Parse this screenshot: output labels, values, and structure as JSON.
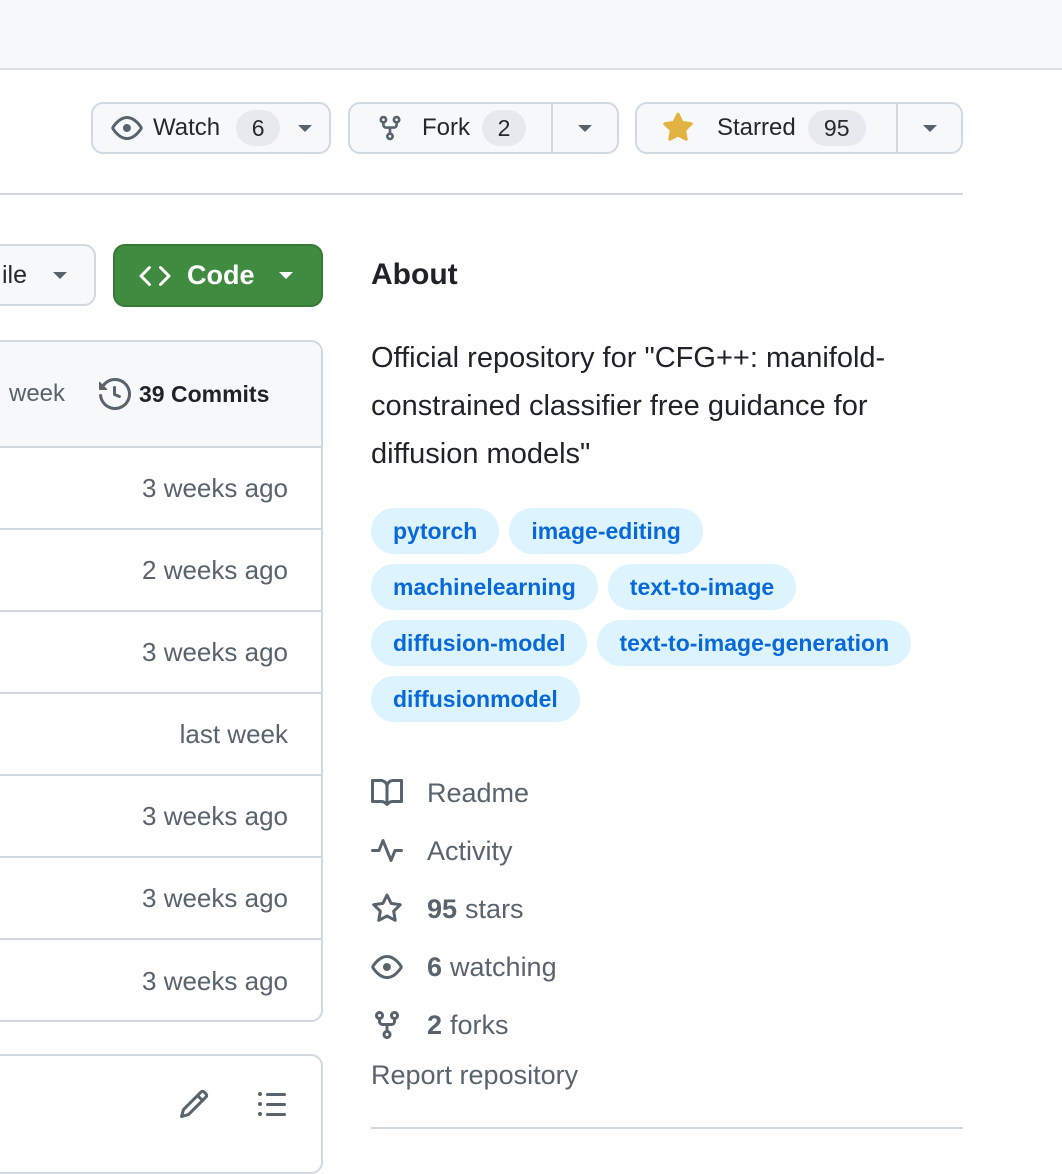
{
  "actions": {
    "watch": {
      "label": "Watch",
      "count": "6"
    },
    "fork": {
      "label": "Fork",
      "count": "2"
    },
    "star": {
      "label": "Starred",
      "count": "95"
    }
  },
  "toolbar": {
    "file_label": "ile",
    "code_label": "Code"
  },
  "files": {
    "header_time": "week",
    "commits_label": "39 Commits",
    "rows": [
      "3 weeks ago",
      "2 weeks ago",
      "3 weeks ago",
      "last week",
      "3 weeks ago",
      "3 weeks ago",
      "3 weeks ago"
    ]
  },
  "about": {
    "title": "About",
    "description": "Official repository for \"CFG++: manifold-constrained classifier free guidance for diffusion models\"",
    "topics": [
      [
        "pytorch",
        "image-editing"
      ],
      [
        "machinelearning",
        "text-to-image"
      ],
      [
        "diffusion-model",
        "text-to-image-generation"
      ],
      [
        "diffusionmodel"
      ]
    ],
    "readme": "Readme",
    "activity": "Activity",
    "stars_count": "95",
    "stars_label": "stars",
    "watching_count": "6",
    "watching_label": "watching",
    "forks_count": "2",
    "forks_label": "forks",
    "report": "Report repository"
  },
  "colors": {
    "accent_green": "#3f8b3f",
    "topic_bg": "#ddf4ff",
    "topic_fg": "#0969da",
    "star": "#e3b341"
  }
}
